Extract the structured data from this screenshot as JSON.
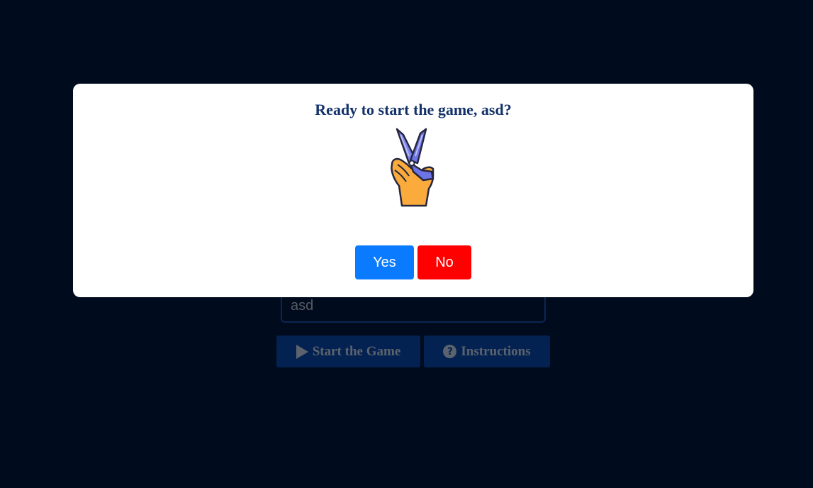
{
  "game": {
    "name_value": "asd",
    "start_label": "Start the Game",
    "instructions_label": "Instructions",
    "start_icon": "play-icon",
    "instructions_icon": "question-circle-icon"
  },
  "modal": {
    "title": "Ready to start the game, asd?",
    "illustration": "victory-hand-scissors-icon",
    "yes_label": "Yes",
    "no_label": "No"
  },
  "colors": {
    "background": "#000c1e",
    "title": "#14326a",
    "yes": "#0a7bff",
    "no": "#ff0000",
    "dim_button": "#032251"
  }
}
